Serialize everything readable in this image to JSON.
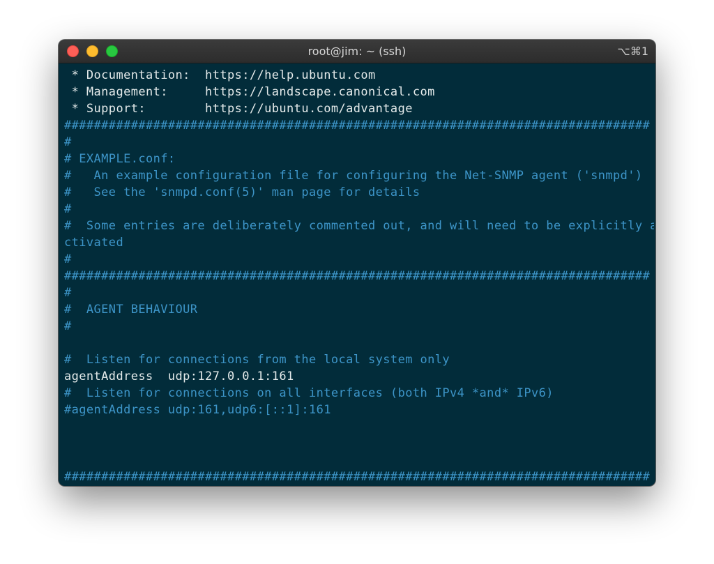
{
  "window": {
    "title": "root@jim: ~ (ssh)",
    "shortcut": "⌥⌘1"
  },
  "colors": {
    "background": "#022c3a",
    "text_white": "#e4eaea",
    "text_comment": "#3d95c8",
    "close": "#fe5f57",
    "minimize": "#febc2e",
    "maximize": "#28c840"
  },
  "terminal": {
    "lines": [
      {
        "text": " * Documentation:  https://help.ubuntu.com",
        "style": "white"
      },
      {
        "text": " * Management:     https://landscape.canonical.com",
        "style": "white"
      },
      {
        "text": " * Support:        https://ubuntu.com/advantage",
        "style": "white"
      },
      {
        "text": "###############################################################################",
        "style": "blue"
      },
      {
        "text": "#",
        "style": "blue"
      },
      {
        "text": "# EXAMPLE.conf:",
        "style": "blue"
      },
      {
        "text": "#   An example configuration file for configuring the Net-SNMP agent ('snmpd')",
        "style": "blue"
      },
      {
        "text": "#   See the 'snmpd.conf(5)' man page for details",
        "style": "blue"
      },
      {
        "text": "#",
        "style": "blue"
      },
      {
        "text": "#  Some entries are deliberately commented out, and will need to be explicitly a",
        "style": "blue"
      },
      {
        "text": "ctivated",
        "style": "blue"
      },
      {
        "text": "#",
        "style": "blue"
      },
      {
        "text": "###############################################################################",
        "style": "blue"
      },
      {
        "text": "#",
        "style": "blue"
      },
      {
        "text": "#  AGENT BEHAVIOUR",
        "style": "blue"
      },
      {
        "text": "#",
        "style": "blue"
      },
      {
        "text": "",
        "style": "blue"
      },
      {
        "text": "#  Listen for connections from the local system only",
        "style": "blue"
      },
      {
        "text": "agentAddress  udp:127.0.0.1:161",
        "style": "white"
      },
      {
        "text": "#  Listen for connections on all interfaces (both IPv4 *and* IPv6)",
        "style": "blue"
      },
      {
        "text": "#agentAddress udp:161,udp6:[::1]:161",
        "style": "blue"
      },
      {
        "text": "",
        "style": "blue"
      },
      {
        "text": "",
        "style": "blue"
      },
      {
        "text": "",
        "style": "blue"
      },
      {
        "text": "###############################################################################",
        "style": "blue"
      }
    ]
  }
}
